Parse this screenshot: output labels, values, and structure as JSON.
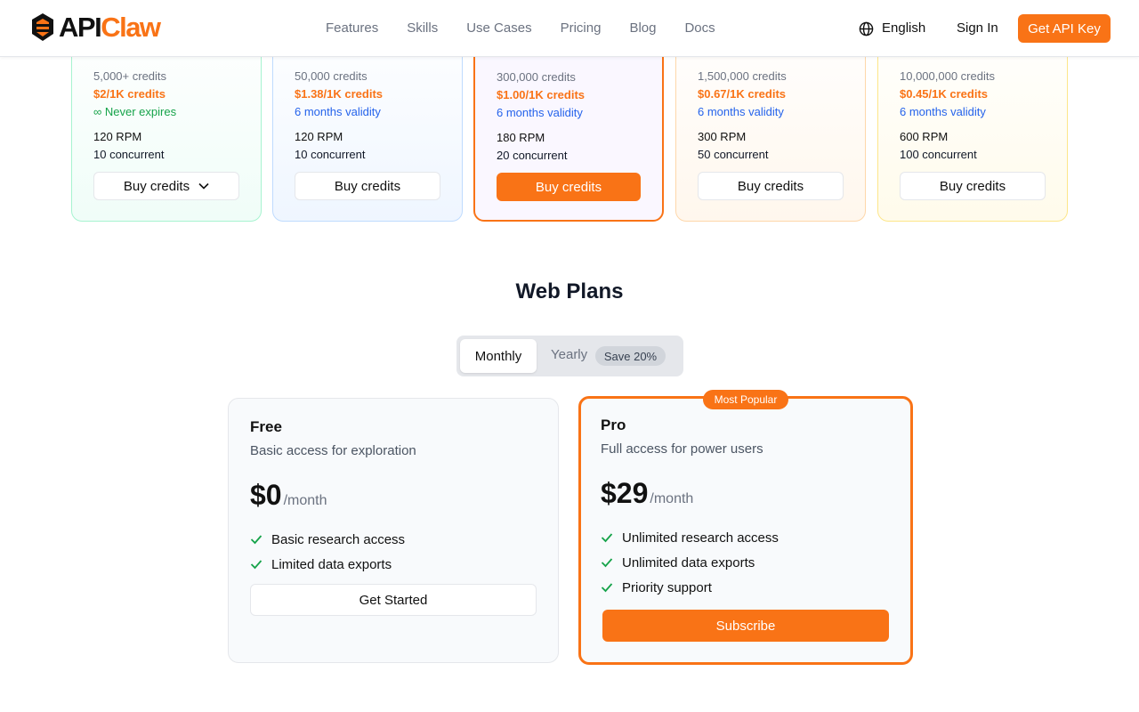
{
  "brand": {
    "api": "API",
    "claw": "Claw"
  },
  "nav": {
    "links": [
      "Features",
      "Skills",
      "Use Cases",
      "Pricing",
      "Blog",
      "Docs"
    ],
    "language": "English",
    "sign_in": "Sign In",
    "cta": "Get API Key"
  },
  "credit_cards": [
    {
      "credits": "5,000+ credits",
      "price": "$2/1K credits",
      "validity": "∞ Never expires",
      "rpm": "120 RPM",
      "concurrent": "10 concurrent",
      "button": "Buy credits"
    },
    {
      "credits": "50,000 credits",
      "price": "$1.38/1K credits",
      "validity": "6 months validity",
      "rpm": "120 RPM",
      "concurrent": "10 concurrent",
      "button": "Buy credits"
    },
    {
      "credits": "300,000 credits",
      "price": "$1.00/1K credits",
      "validity": "6 months validity",
      "rpm": "180 RPM",
      "concurrent": "20 concurrent",
      "button": "Buy credits"
    },
    {
      "credits": "1,500,000 credits",
      "price": "$0.67/1K credits",
      "validity": "6 months validity",
      "rpm": "300 RPM",
      "concurrent": "50 concurrent",
      "button": "Buy credits"
    },
    {
      "credits": "10,000,000 credits",
      "price": "$0.45/1K credits",
      "validity": "6 months validity",
      "rpm": "600 RPM",
      "concurrent": "100 concurrent",
      "button": "Buy credits"
    }
  ],
  "web_plans": {
    "title": "Web Plans",
    "toggle": {
      "monthly": "Monthly",
      "yearly": "Yearly",
      "save": "Save 20%"
    },
    "popular_badge": "Most Popular",
    "plans": [
      {
        "name": "Free",
        "desc": "Basic access for exploration",
        "price": "$0",
        "period": "/month",
        "features": [
          "Basic research access",
          "Limited data exports"
        ],
        "button": "Get Started"
      },
      {
        "name": "Pro",
        "desc": "Full access for power users",
        "price": "$29",
        "period": "/month",
        "features": [
          "Unlimited research access",
          "Unlimited data exports",
          "Priority support"
        ],
        "button": "Subscribe"
      }
    ]
  },
  "colors": {
    "accent": "#f97316",
    "blue": "#2563eb",
    "green": "#16a34a"
  }
}
